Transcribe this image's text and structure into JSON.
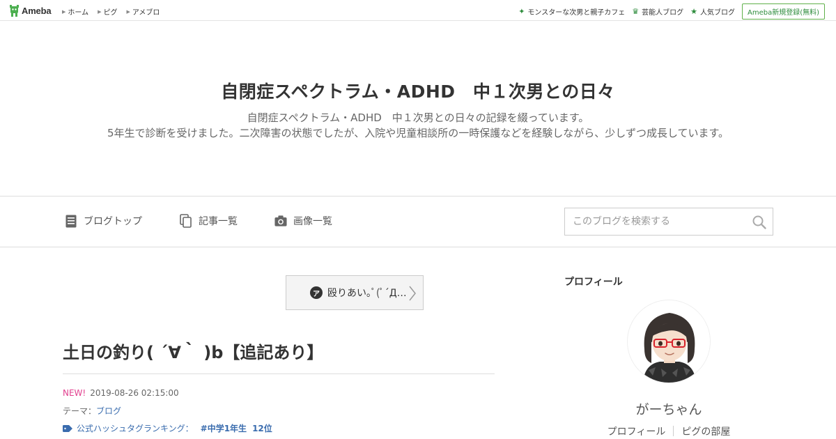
{
  "topbar": {
    "logo_text": "Ameba",
    "nav": [
      "ホーム",
      "ピグ",
      "アメブロ"
    ],
    "links": [
      {
        "icon": "sparkle-icon",
        "label": "モンスターな次男と親子カフェ"
      },
      {
        "icon": "crown-icon",
        "label": "芸能人ブログ"
      },
      {
        "icon": "star-icon",
        "label": "人気ブログ"
      }
    ],
    "register_label": "Ameba新規登録(無料)"
  },
  "blog": {
    "title": "自閉症スペクトラム・ADHD　中１次男との日々",
    "description_line1": "自閉症スペクトラム・ADHD　中１次男との日々の記録を綴っています。",
    "description_line2": "5年生で診断を受けました。二次障害の状態でしたが、入院や児童相談所の一時保護などを経験しながら、少しずつ成長しています。"
  },
  "navbar": {
    "items": [
      {
        "icon": "blog-top-icon",
        "label": "ブログトップ"
      },
      {
        "icon": "entry-list-icon",
        "label": "記事一覧"
      },
      {
        "icon": "camera-icon",
        "label": "画像一覧"
      }
    ],
    "search_placeholder": "このブログを検索する"
  },
  "prev_entry": {
    "badge": "ア",
    "label": "殴りあい｡ﾟ(ﾟ´Д…"
  },
  "entry": {
    "title": "土日の釣り( ´∀｀ )b【追記あり】",
    "new_label": "NEW!",
    "datetime": "2019-08-26 02:15:00",
    "theme_prefix": "テーマ：",
    "theme": "ブログ",
    "hashtag_prefix": "公式ハッシュタグランキング：",
    "hashtag": "#中学1年生",
    "hashtag_rank": "12位"
  },
  "sidebar": {
    "heading": "プロフィール",
    "name": "がーちゃん",
    "links": [
      "プロフィール",
      "ピグの部屋"
    ]
  },
  "colors": {
    "brand_green": "#2d8c3c",
    "link_blue": "#3a6cae",
    "new_pink": "#e2408f"
  }
}
